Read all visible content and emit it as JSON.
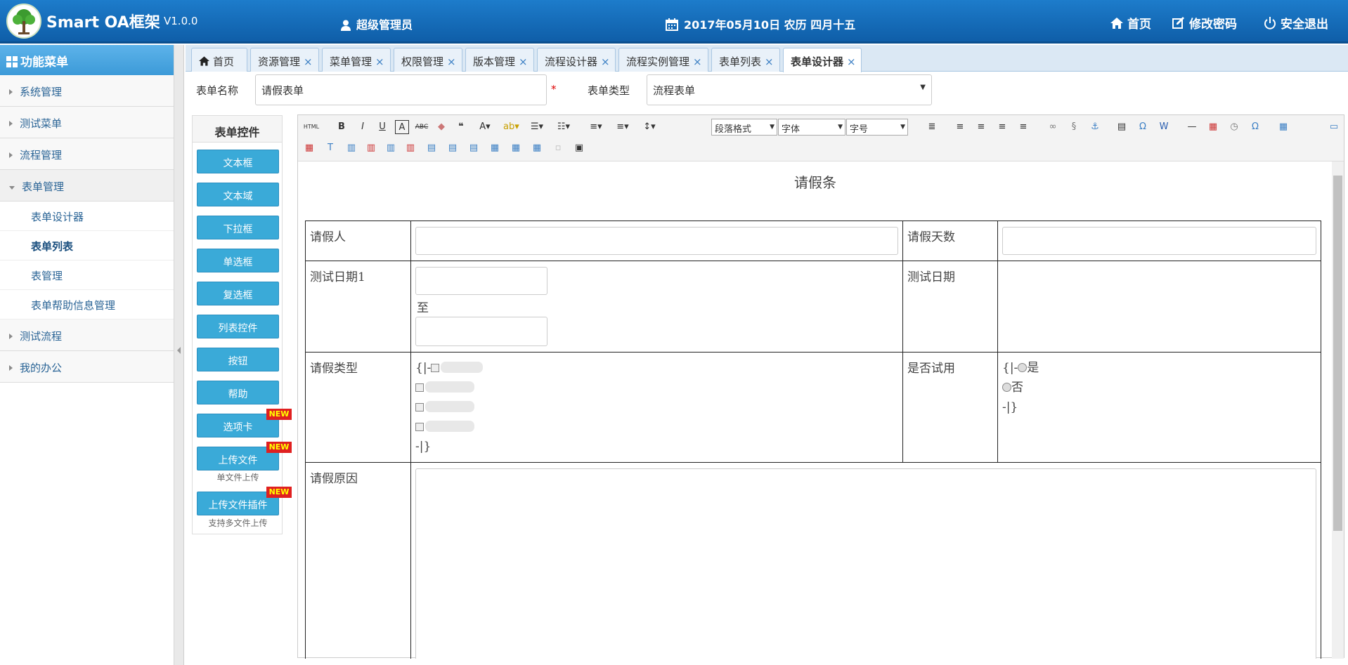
{
  "header": {
    "brand": "Smart OA框架",
    "version": "V1.0.0",
    "user": "超级管理员",
    "date": "2017年05月10日 农历 四月十五",
    "nav": {
      "home": "首页",
      "change_password": "修改密码",
      "logout": "安全退出"
    }
  },
  "sidebar": {
    "title": "功能菜单",
    "groups": [
      {
        "label": "系统管理"
      },
      {
        "label": "测试菜单"
      },
      {
        "label": "流程管理"
      },
      {
        "label": "表单管理"
      },
      {
        "label": "测试流程"
      },
      {
        "label": "我的办公"
      }
    ],
    "form_mgmt_items": [
      {
        "label": "表单设计器"
      },
      {
        "label": "表单列表"
      },
      {
        "label": "表管理"
      },
      {
        "label": "表单帮助信息管理"
      }
    ]
  },
  "tabs": [
    {
      "label": "首页"
    },
    {
      "label": "资源管理"
    },
    {
      "label": "菜单管理"
    },
    {
      "label": "权限管理"
    },
    {
      "label": "版本管理"
    },
    {
      "label": "流程设计器"
    },
    {
      "label": "流程实例管理"
    },
    {
      "label": "表单列表"
    },
    {
      "label": "表单设计器"
    }
  ],
  "close_glyph": "×",
  "form": {
    "name_label": "表单名称",
    "name_value": "请假表单",
    "required_mark": "*",
    "type_label": "表单类型",
    "type_value": "流程表单"
  },
  "controls": {
    "title": "表单控件",
    "buttons": [
      {
        "label": "文本框"
      },
      {
        "label": "文本域"
      },
      {
        "label": "下拉框"
      },
      {
        "label": "单选框"
      },
      {
        "label": "复选框"
      },
      {
        "label": "列表控件"
      },
      {
        "label": "按钮"
      },
      {
        "label": "帮助"
      },
      {
        "label": "选项卡"
      },
      {
        "label": "上传文件"
      },
      {
        "label": "上传文件插件"
      }
    ],
    "new_badge": "NEW",
    "upload_hint": "单文件上传",
    "upload_plugin_hint": "支持多文件上传"
  },
  "editor": {
    "toolbar": {
      "html": "HTML",
      "paragraph_format": "段落格式",
      "font": "字体",
      "font_size": "字号"
    },
    "doc_title": "请假条",
    "rows": {
      "applicant": "请假人",
      "days": "请假天数",
      "test_date1": "测试日期1",
      "to": "至",
      "test_date": "测试日期",
      "leave_type": "请假类型",
      "is_trial": "是否试用",
      "reason": "请假原因"
    },
    "leave_type_open": "{|-",
    "leave_type_close": "-|}",
    "trial_open": "{|-",
    "trial_yes": "是",
    "trial_no": "否",
    "trial_close": "-|}"
  }
}
